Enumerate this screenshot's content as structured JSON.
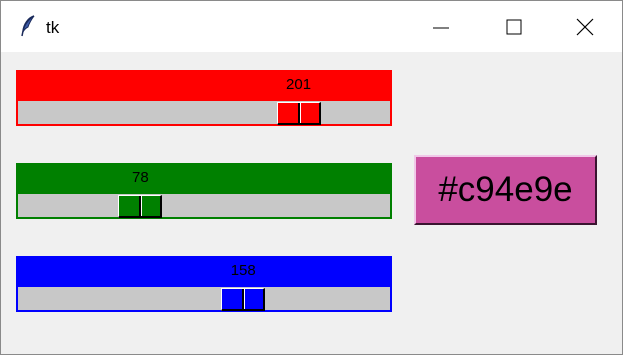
{
  "window": {
    "title": "tk"
  },
  "sliders": [
    {
      "name": "red",
      "value": 201,
      "min": 0,
      "max": 255,
      "color": "#ff0000",
      "trough_color": "#c8c8c8"
    },
    {
      "name": "green",
      "value": 78,
      "min": 0,
      "max": 255,
      "color": "#008000",
      "trough_color": "#c8c8c8"
    },
    {
      "name": "blue",
      "value": 158,
      "min": 0,
      "max": 255,
      "color": "#0000ff",
      "trough_color": "#c8c8c8"
    }
  ],
  "swatch": {
    "label": "#c94e9e",
    "color": "#c94e9e"
  },
  "icons": {
    "app": "feather-icon",
    "minimize": "minimize-icon",
    "maximize": "maximize-icon",
    "close": "close-icon"
  }
}
